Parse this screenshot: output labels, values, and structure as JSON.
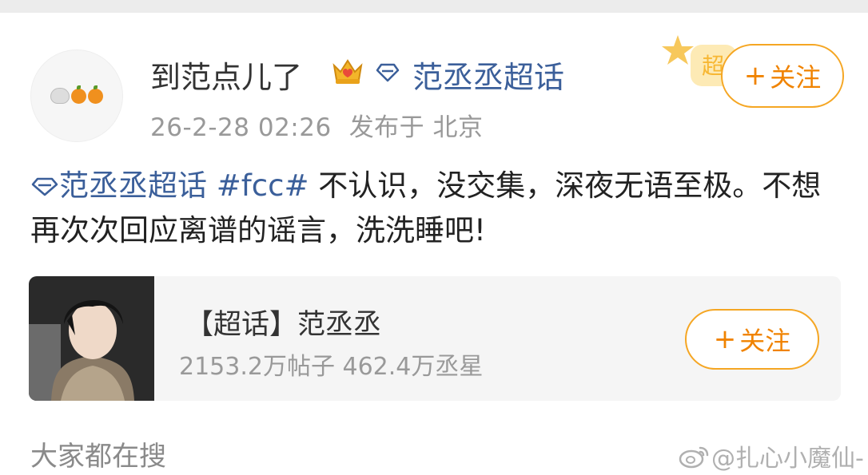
{
  "post": {
    "username": "到范点儿了",
    "supertopic_link": "范丞丞超话",
    "timestamp": "26-2-28 02:26",
    "location": "发布于 北京",
    "follow_label": "关注",
    "text": {
      "topic": "范丞丞超话",
      "hashtag": "#fcc#",
      "body": " 不认识，没交集，深夜无语至极。不想再次次回应离谱的谣言，洗洗睡吧!"
    },
    "badge_text": "超"
  },
  "card": {
    "title": "【超话】范丞丞",
    "stats": "2153.2万帖子 462.4万丞星",
    "follow_label": "关注"
  },
  "section": {
    "title": "大家都在搜"
  },
  "watermark": {
    "text": "@扎心小魔仙-"
  },
  "icons": {
    "avatar": [
      "rice-bowl-icon",
      "orange-icon",
      "orange-icon"
    ],
    "crown": "crown-icon",
    "diamond": "diamond-icon",
    "weibo": "weibo-logo-icon"
  },
  "colors": {
    "link": "#3b5f9a",
    "follow": "#f08300",
    "follow_border": "#f5a623",
    "muted": "#999999"
  }
}
